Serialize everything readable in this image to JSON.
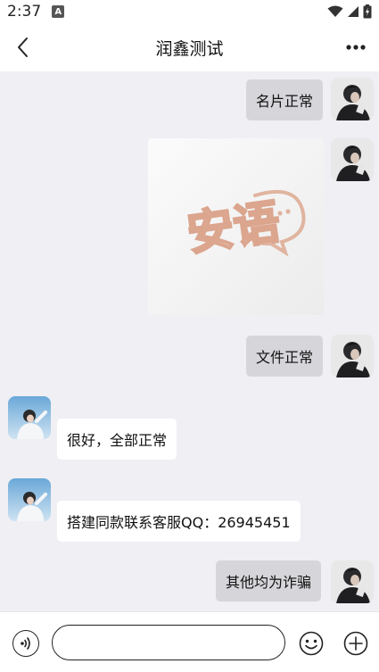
{
  "status_bar": {
    "time": "2:37",
    "notification_badge": "A"
  },
  "header": {
    "title": "润鑫测试",
    "back_icon": "chevron-left-icon",
    "more_icon": "more-horizontal-icon"
  },
  "messages": [
    {
      "sender": "me",
      "type": "text",
      "text": "名片正常"
    },
    {
      "sender": "me",
      "type": "image",
      "image_text": "安语"
    },
    {
      "sender": "me",
      "type": "text",
      "text": "文件正常"
    },
    {
      "sender": "other",
      "type": "text",
      "text": "很好，全部正常"
    },
    {
      "sender": "other",
      "type": "text",
      "text": "搭建同款联系客服QQ：26945451"
    },
    {
      "sender": "me",
      "type": "text",
      "text": "其他均为诈骗"
    }
  ],
  "input_bar": {
    "text_value": "",
    "voice_icon": "voice-icon",
    "emoji_icon": "emoji-icon",
    "plus_icon": "plus-icon"
  },
  "colors": {
    "chat_background": "#efeff4",
    "my_bubble": "#d6d6da",
    "other_bubble": "#ffffff"
  }
}
